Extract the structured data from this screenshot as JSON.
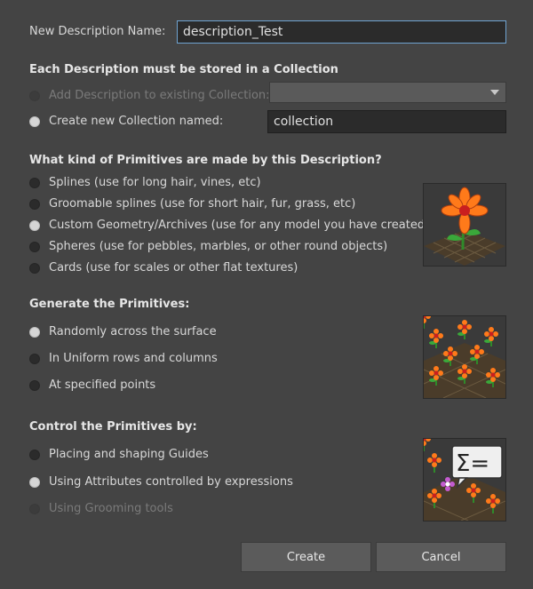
{
  "name_row": {
    "label": "New Description Name:",
    "value": "description_Test"
  },
  "collection": {
    "title": "Each Description must be stored in a Collection",
    "existing_label": "Add Description to existing Collection:",
    "existing_value": "",
    "new_label": "Create new Collection named:",
    "new_value": "collection"
  },
  "primitives": {
    "title": "What kind of Primitives are made by this Description?",
    "options": [
      {
        "label": "Splines (use for long hair, vines, etc)",
        "checked": false
      },
      {
        "label": "Groomable splines (use for short hair, fur, grass, etc)",
        "checked": false
      },
      {
        "label": "Custom Geometry/Archives (use for any model you have created)",
        "checked": true
      },
      {
        "label": "Spheres (use for pebbles, marbles, or other round objects)",
        "checked": false
      },
      {
        "label": "Cards (use for scales or other flat textures)",
        "checked": false
      }
    ]
  },
  "generate": {
    "title": "Generate the Primitives:",
    "options": [
      {
        "label": "Randomly across the surface",
        "checked": true
      },
      {
        "label": "In Uniform rows and columns",
        "checked": false
      },
      {
        "label": "At specified points",
        "checked": false
      }
    ]
  },
  "control": {
    "title": "Control the Primitives by:",
    "options": [
      {
        "label": "Placing and shaping Guides",
        "checked": false
      },
      {
        "label": "Using Attributes controlled by expressions",
        "checked": true
      },
      {
        "label": "Using Grooming tools",
        "checked": false,
        "disabled": true
      }
    ]
  },
  "buttons": {
    "create": "Create",
    "cancel": "Cancel"
  },
  "colors": {
    "accent": "#6fa3d1",
    "background": "#444444",
    "field": "#2b2b2b"
  }
}
